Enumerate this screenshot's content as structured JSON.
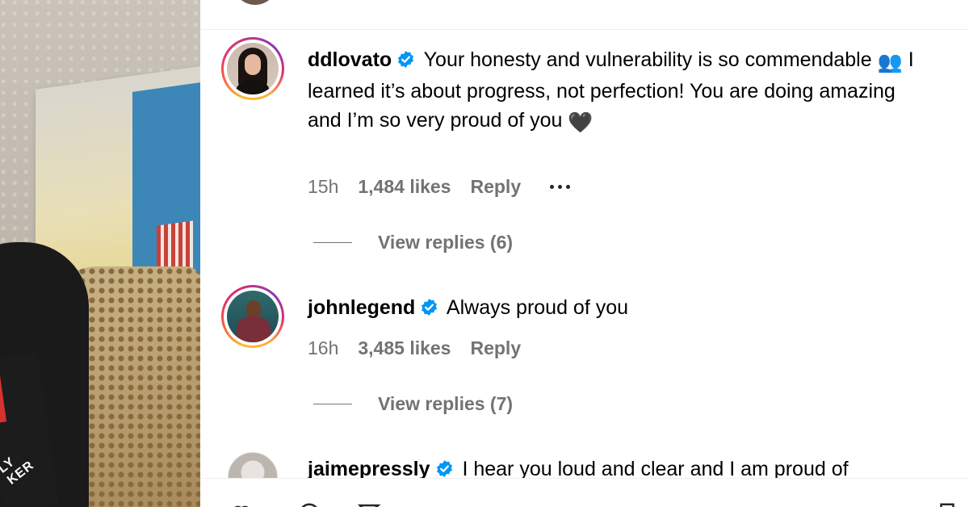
{
  "photo": {
    "book_text": "LY\nKER"
  },
  "comments": [
    {
      "username": "ddlovato",
      "text_part1": "Your honesty and vulnerability is so commendable",
      "emoji1": "👥",
      "text_part2": "I learned it’s about progress, not perfection! You are doing amazing and I’m so very proud of you",
      "emoji2": "🖤",
      "time": "15h",
      "likes": "1,484 likes",
      "reply_label": "Reply",
      "view_replies": "View replies (6)"
    },
    {
      "username": "johnlegend",
      "text": "Always proud of you",
      "time": "16h",
      "likes": "3,485 likes",
      "reply_label": "Reply",
      "view_replies": "View replies (7)"
    },
    {
      "username": "jaimepressly",
      "text": "I hear you loud and clear and I am proud of"
    }
  ],
  "colors": {
    "verified_blue": "#0095f6",
    "meta_gray": "#737373"
  },
  "icons": {
    "verified": "verified-badge-icon",
    "more": "more-options-icon",
    "heart": "heart-icon"
  }
}
